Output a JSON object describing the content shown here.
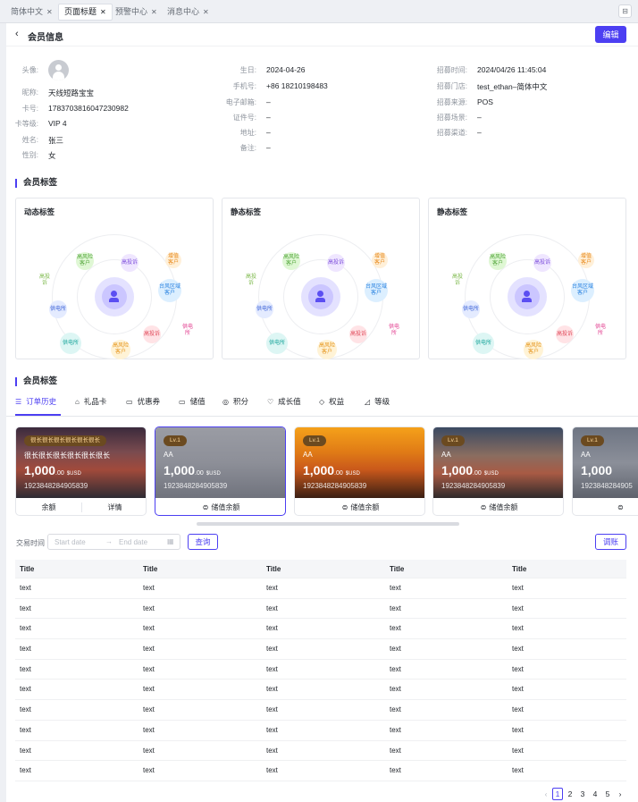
{
  "tabs": [
    {
      "label": "简体中文"
    },
    {
      "label": "页面标题"
    },
    {
      "label": "预警中心"
    },
    {
      "label": "消息中心"
    }
  ],
  "icons": {
    "close": "✕",
    "back": "‹",
    "tool": "⊟",
    "calendar": "▦",
    "arrow": "→"
  },
  "header": {
    "title": "会员信息",
    "edit_label": "编辑"
  },
  "info": {
    "col1": [
      {
        "label": "头像:",
        "value": ""
      },
      {
        "label": "昵称:",
        "value": "天线短路宝宝"
      },
      {
        "label": "卡号:",
        "value": "1783703816047230982"
      },
      {
        "label": "卡等级:",
        "value": "VIP 4"
      },
      {
        "label": "姓名:",
        "value": "张三"
      },
      {
        "label": "性别:",
        "value": "女"
      }
    ],
    "col2": [
      {
        "label": "生日:",
        "value": "2024-04-26"
      },
      {
        "label": "手机号:",
        "value": "+86 18210198483"
      },
      {
        "label": "电子邮箱:",
        "value": "–"
      },
      {
        "label": "证件号:",
        "value": "–"
      },
      {
        "label": "地址:",
        "value": "–"
      },
      {
        "label": "备注:",
        "value": "–"
      }
    ],
    "col3": [
      {
        "label": "招募时间:",
        "value": "2024/04/26 11:45:04"
      },
      {
        "label": "招募门店:",
        "value": "test_ethan–简体中文"
      },
      {
        "label": "招募来源:",
        "value": "POS"
      },
      {
        "label": "招募场景:",
        "value": "–"
      },
      {
        "label": "招募渠道:",
        "value": "–"
      }
    ]
  },
  "tags_section": {
    "title": "会员标签",
    "cards": [
      {
        "title": "动态标签"
      },
      {
        "title": "静态标签"
      },
      {
        "title": "静态标签"
      }
    ],
    "bubbles": [
      {
        "text": "高风险客户",
        "color": "#dff7d4",
        "text_color": "#52a63a"
      },
      {
        "text": "高投诉",
        "color": "#efe6ff",
        "text_color": "#7c4ddb"
      },
      {
        "text": "增值客户",
        "color": "#fff0d9",
        "text_color": "#e8891a"
      },
      {
        "text": "高投诉",
        "color": "#ffffff",
        "text_color": "#7cb84a"
      },
      {
        "text": "台风区域客户",
        "color": "#dcefff",
        "text_color": "#2b83e0"
      },
      {
        "text": "供电所",
        "color": "#e4ebff",
        "text_color": "#3e64d8"
      },
      {
        "text": "供电所",
        "color": "#ffffff",
        "text_color": "#e23e8f"
      },
      {
        "text": "高投诉",
        "color": "#ffe3e6",
        "text_color": "#e04a5a"
      },
      {
        "text": "供电所",
        "color": "#ddf6f4",
        "text_color": "#1aa59b"
      },
      {
        "text": "高风险客户",
        "color": "#fff3d6",
        "text_color": "#e6951c"
      }
    ]
  },
  "tabs_section": {
    "title": "会员标签",
    "tabs": [
      {
        "label": "订单历史",
        "icon": "☰"
      },
      {
        "label": "礼品卡",
        "icon": "⌂"
      },
      {
        "label": "优惠券",
        "icon": "▭"
      },
      {
        "label": "储值",
        "icon": "▭"
      },
      {
        "label": "积分",
        "icon": "◎"
      },
      {
        "label": "成长值",
        "icon": "♡"
      },
      {
        "label": "权益",
        "icon": "◇"
      },
      {
        "label": "等级",
        "icon": "◿"
      }
    ]
  },
  "cards": [
    {
      "badge": "很长很长很长很长很长很长",
      "name": "很长很长很长很长很长很长",
      "amount": "1,000",
      "decimals": ".00",
      "currency": "$USD",
      "number": "1923848284905839",
      "footer_left": "余额",
      "footer_right": "详情",
      "footer": ""
    },
    {
      "badge": "Lv.1",
      "name": "AA",
      "amount": "1,000",
      "decimals": ".00",
      "currency": "$USD",
      "number": "1923848284905839",
      "footer_left": "",
      "footer_right": "",
      "footer": "储值余额"
    },
    {
      "badge": "Lv.1",
      "name": "AA",
      "amount": "1,000",
      "decimals": ".00",
      "currency": "$USD",
      "number": "1923848284905839",
      "footer_left": "",
      "footer_right": "",
      "footer": "储值余额"
    },
    {
      "badge": "Lv.1",
      "name": "AA",
      "amount": "1,000",
      "decimals": ".00",
      "currency": "$USD",
      "number": "1923848284905839",
      "footer_left": "",
      "footer_right": "",
      "footer": "储值余额"
    },
    {
      "badge": "Lv.1",
      "name": "AA",
      "amount": "1,000",
      "decimals": "",
      "currency": "",
      "number": "1923848284905",
      "footer_left": "",
      "footer_right": "",
      "footer": ""
    }
  ],
  "filter": {
    "label": "交易时间",
    "start_placeholder": "Start date",
    "end_placeholder": "End date",
    "query_label": "查询",
    "adjust_label": "调账"
  },
  "table": {
    "headers": [
      "Title",
      "Title",
      "Title",
      "Title",
      "Title"
    ],
    "rows": [
      [
        "text",
        "text",
        "text",
        "text",
        "text"
      ],
      [
        "text",
        "text",
        "text",
        "text",
        "text"
      ],
      [
        "text",
        "text",
        "text",
        "text",
        "text"
      ],
      [
        "text",
        "text",
        "text",
        "text",
        "text"
      ],
      [
        "text",
        "text",
        "text",
        "text",
        "text"
      ],
      [
        "text",
        "text",
        "text",
        "text",
        "text"
      ],
      [
        "text",
        "text",
        "text",
        "text",
        "text"
      ],
      [
        "text",
        "text",
        "text",
        "text",
        "text"
      ],
      [
        "text",
        "text",
        "text",
        "text",
        "text"
      ],
      [
        "text",
        "text",
        "text",
        "text",
        "text"
      ]
    ]
  },
  "pagination": {
    "prev": "‹",
    "next": "›",
    "pages": [
      "1",
      "2",
      "3",
      "4",
      "5"
    ],
    "current": "1"
  },
  "colors": {
    "accent": "#4c3ff2"
  }
}
